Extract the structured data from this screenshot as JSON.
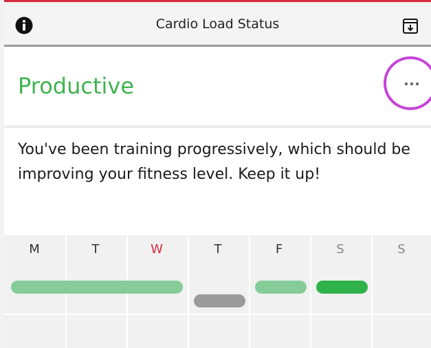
{
  "header": {
    "title": "Cardio Load Status",
    "left_icon": "info-icon",
    "right_icon": "export-icon"
  },
  "status": {
    "title": "Productive",
    "title_color": "#3fb34f",
    "more_icon": "more-horizontal-icon",
    "highlight_color": "#c643d8"
  },
  "description": "You've been training progressively, which should be improving your fitness level. Keep it up!",
  "week": {
    "days": [
      {
        "label": "M",
        "style": "normal"
      },
      {
        "label": "T",
        "style": "normal"
      },
      {
        "label": "W",
        "style": "today"
      },
      {
        "label": "T",
        "style": "normal"
      },
      {
        "label": "F",
        "style": "normal"
      },
      {
        "label": "S",
        "style": "weekend"
      },
      {
        "label": "S",
        "style": "weekend"
      }
    ],
    "bars": [
      {
        "status": "productive",
        "color": "#86cc98"
      },
      {
        "status": "detraining",
        "color": "#9a9a9a"
      },
      {
        "status": "productive",
        "color": "#86cc98"
      },
      {
        "status": "productive-strong",
        "color": "#2fb24a"
      }
    ]
  },
  "colors": {
    "accent_red": "#d72a3f",
    "header_bg": "#f4f4f4"
  }
}
